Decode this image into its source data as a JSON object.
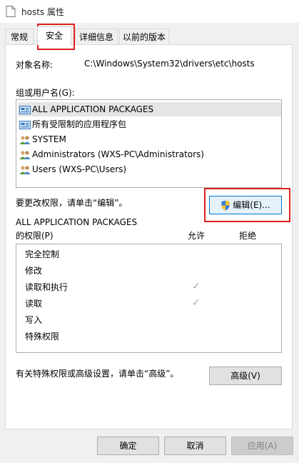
{
  "window": {
    "title": "hosts 属性"
  },
  "tabs": [
    "常规",
    "安全",
    "详细信息",
    "以前的版本"
  ],
  "security": {
    "object_name_label": "对象名称:",
    "object_name_value": "C:\\Windows\\System32\\drivers\\etc\\hosts",
    "group_label": "组或用户名(G):",
    "users": [
      "ALL APPLICATION PACKAGES",
      "所有受限制的应用程序包",
      "SYSTEM",
      "Administrators (WXS-PC\\Administrators)",
      "Users (WXS-PC\\Users)"
    ],
    "change_hint": "要更改权限，请单击“编辑”。",
    "edit_button": "编辑(E)...",
    "perm_for_line1": "ALL APPLICATION PACKAGES",
    "perm_for_line2": "的权限(P)",
    "allow_header": "允许",
    "deny_header": "拒绝",
    "permissions": [
      "完全控制",
      "修改",
      "读取和执行",
      "读取",
      "写入",
      "特殊权限"
    ],
    "advanced_hint": "有关特殊权限或高级设置，请单击“高级”。",
    "advanced_button": "高级(V)"
  },
  "footer": {
    "ok": "确定",
    "cancel": "取消",
    "apply": "应用(A)"
  },
  "colors": {
    "highlight": "#e02020",
    "selected_row": "#e5e5e5",
    "check": "#a9a9a9"
  }
}
